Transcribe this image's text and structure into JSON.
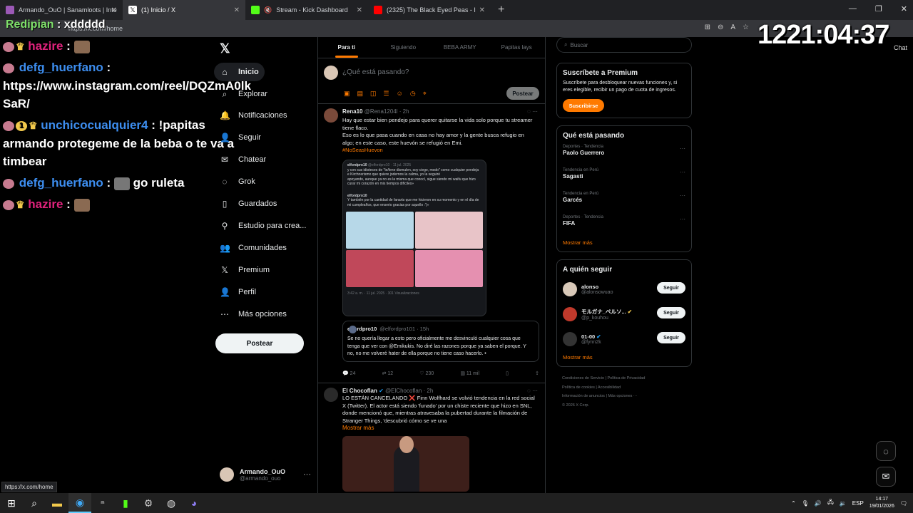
{
  "browser": {
    "tabs": [
      {
        "label": "Armando_OuO | Sanamloots | Inte",
        "color": "#9b59b6"
      },
      {
        "label": "(1) Inicio / X",
        "color": "#ffffff"
      },
      {
        "label": "Stream - Kick Dashboard",
        "color": "#53fc18"
      },
      {
        "label": "(2325) The Black Eyed Peas - I",
        "color": "#ff0000"
      }
    ],
    "new_tab": "+",
    "url": "https://x.com/home",
    "chat_label": "Chat",
    "status_url": "https://x.com/home"
  },
  "stream_overlay": {
    "timer": "1221:04:37",
    "top_user": "Redipian",
    "top_msg": ": xddddd",
    "top_name_hidden": "hazire",
    "lines": [
      {
        "user": "hazire",
        "color": "pink",
        "msg": ":"
      },
      {
        "user": "defg_huerfano",
        "color": "blue",
        "msg": ":"
      },
      {
        "user": "",
        "color": "",
        "msg": "https://www.instagram.com/reel/DQZmA0lk"
      },
      {
        "user": "",
        "color": "",
        "msg": "SaR/"
      },
      {
        "user": "unchicocualquier4",
        "color": "blue",
        "msg": ": !papitas"
      },
      {
        "user": "",
        "color": "",
        "msg": "armando protegeme de la beba o te va a"
      },
      {
        "user": "",
        "color": "",
        "msg": "timbear"
      },
      {
        "user": "defg_huerfano",
        "color": "blue",
        "msg": "go ruleta"
      },
      {
        "user": "hazire",
        "color": "pink",
        "msg": ":"
      }
    ]
  },
  "nav": {
    "items": [
      {
        "label": "Inicio",
        "icon": "home-icon"
      },
      {
        "label": "Explorar",
        "icon": "search-icon"
      },
      {
        "label": "Notificaciones",
        "icon": "bell-icon"
      },
      {
        "label": "Seguir",
        "icon": "follow-icon"
      },
      {
        "label": "Chatear",
        "icon": "mail-icon"
      },
      {
        "label": "Grok",
        "icon": "grok-icon"
      },
      {
        "label": "Guardados",
        "icon": "bookmark-icon"
      },
      {
        "label": "Estudio para crea...",
        "icon": "studio-icon"
      },
      {
        "label": "Comunidades",
        "icon": "communities-icon"
      },
      {
        "label": "Premium",
        "icon": "x-logo-icon"
      },
      {
        "label": "Perfil",
        "icon": "profile-icon"
      },
      {
        "label": "Más opciones",
        "icon": "more-icon"
      }
    ],
    "post_button": "Postear",
    "account": {
      "name": "Armando_OuO",
      "handle": "@armando_ouo"
    }
  },
  "feed": {
    "tabs": [
      "Para ti",
      "Siguiendo",
      "BEBA ARMY",
      "Papitas lays"
    ],
    "composer_placeholder": "¿Qué está pasando?",
    "composer_button": "Postear",
    "tweets": [
      {
        "name": "Rena10",
        "handle": "@Rena1204l · 2h",
        "text1": "Hay que estar bien pendejo para querer quitarse la vida solo porque tu streamer tiene flaco.",
        "text2": "Eso es lo que pasa cuando en casa no hay amor y la gente busca refugio en algo; en este caso, este huevón se refugió en Emi.",
        "hashtag": "#NoSeasHuevon",
        "embed": {
          "user": "elfordpro10",
          "handle": "@elfordpro10 · 11 jul. 2025",
          "line1": "y con sus idioteces de \"te/lene dismulen, soy ciego, modo\" como cualquier pendeja e Kirchnerismo que quiere jodernos la calma, yo la seguiré",
          "line2": "apoyando, aunque ya no es la misma que conocí, sigue siendo mi waifu que hizo curar mi corazón en mis tiempos difíciles»",
          "line3": "Y también por la cantidad de fanarts que me hicieron en su momento y en el día de mi cumpleaños, que enserio gracias por aquello :')»",
          "stamp": "3:42 a. m. · 11 jul. 2025 · 301 Visualizaciones"
        },
        "quote": {
          "name": "elfordpro10",
          "handle": "@elfordpro101 · 15h",
          "text": "Se no quería llegar a esto pero oficialmente me desvinculó cualquier cosa que tenga que ver con @Emikukis. No diré las razones porque ya saben el porque. Y no, no me volveré hater de ella porque no tiene caso hacerlo. •"
        },
        "actions": {
          "replies": "24",
          "reposts": "12",
          "likes": "230",
          "views": "11 mil"
        }
      },
      {
        "name": "El Chocoflan",
        "handle": "@ElChocoflan · 2h",
        "text1": "LO ESTÁN CANCELANDO ❌ Finn Wolfhard se volvió tendencia en la red social X (Twitter). El actor está siendo 'funado' por un chiste reciente que hizo en SNL, donde mencionó que, mientras atravesaba la pubertad durante la filmación de Stranger Things, 'descubrió cómo se ve una",
        "more": "Mostrar más"
      }
    ]
  },
  "sidebar": {
    "search_placeholder": "Buscar",
    "premium": {
      "title": "Suscríbete a Premium",
      "text": "Suscríbete para desbloquear nuevas funciones y, si eres elegible, recibir un pago de cuota de ingresos.",
      "button": "Suscribirse"
    },
    "trends": {
      "title": "Qué está pasando",
      "items": [
        {
          "cat": "Deportes · Tendencia",
          "title": "Paolo Guerrero"
        },
        {
          "cat": "Tendencia en Perú",
          "title": "Sagasti"
        },
        {
          "cat": "Tendencia en Perú",
          "title": "Garcés"
        },
        {
          "cat": "Deportes · Tendencia",
          "title": "FIFA"
        }
      ],
      "more": "Mostrar más"
    },
    "follow": {
      "title": "A quién seguir",
      "items": [
        {
          "name": "alonso",
          "handle": "@alonsowuao",
          "color": "#d8c8b8"
        },
        {
          "name": "モルガナ_ペルソ...",
          "handle": "@p_kouhou",
          "color": "#c0392b"
        },
        {
          "name": "01-00",
          "handle": "@fynn2k",
          "color": "#333333"
        }
      ],
      "button": "Seguir",
      "more": "Mostrar más"
    },
    "footer": [
      "Condiciones de Servicio",
      "Política de Privacidad",
      "Política de cookies",
      "Accesibilidad",
      "Información de anuncios",
      "Más opciones ···",
      "© 2026 X Corp."
    ]
  },
  "taskbar": {
    "lang": "ESP",
    "time": "14:17",
    "date": "19/01/2026"
  },
  "colors": {
    "accent": "#ff7a00",
    "bg": "#000000"
  }
}
